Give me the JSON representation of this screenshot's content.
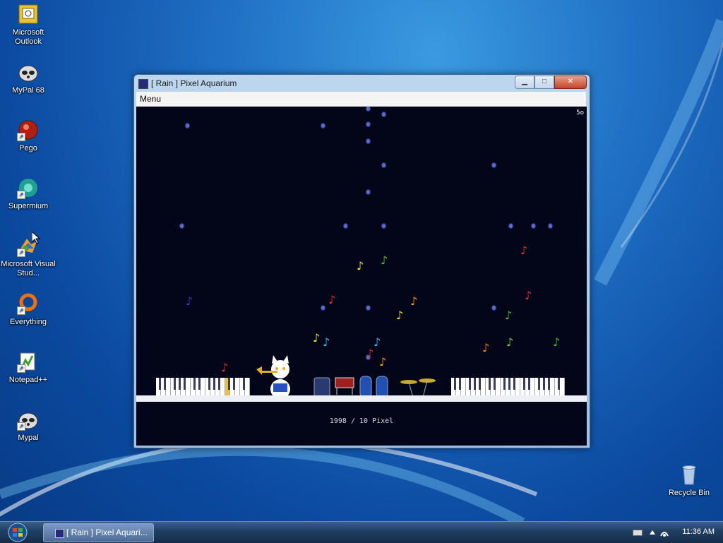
{
  "desktop": {
    "icons": [
      {
        "label": "Microsoft Outlook",
        "icon": "outlook-icon"
      },
      {
        "label": "MyPal 68",
        "icon": "raccoon-icon"
      },
      {
        "label": "Pego",
        "icon": "pego-icon"
      },
      {
        "label": "Supermium",
        "icon": "supermium-icon"
      },
      {
        "label": "Microsoft Visual Stud...",
        "icon": "visual-studio-icon"
      },
      {
        "label": "Everything",
        "icon": "everything-icon"
      },
      {
        "label": "Notepad++",
        "icon": "notepadpp-icon"
      },
      {
        "label": "Mypal",
        "icon": "raccoon-icon"
      },
      {
        "label": "Recycle Bin",
        "icon": "recycle-bin-icon"
      }
    ]
  },
  "window": {
    "title": "[ Rain ] Pixel Aquarium",
    "menu": "Menu",
    "fps": "5o",
    "credit": "1998 / 10  Pixel",
    "colors": {
      "background": "#030518",
      "rain": "#5a6ad8",
      "floor": "#eef0f5"
    }
  },
  "notes": [
    {
      "color": "#f0e040"
    },
    {
      "color": "#40c040"
    },
    {
      "color": "#e03030"
    },
    {
      "color": "#e03030"
    },
    {
      "color": "#3040d0"
    },
    {
      "color": "#e03030"
    },
    {
      "color": "#f0a020"
    },
    {
      "color": "#e0e040"
    },
    {
      "color": "#40c040"
    },
    {
      "color": "#40c040"
    },
    {
      "color": "#f0e040"
    },
    {
      "color": "#40c0e0"
    },
    {
      "color": "#40c0e0"
    },
    {
      "color": "#e03030"
    },
    {
      "color": "#f0a020"
    },
    {
      "color": "#f08020"
    },
    {
      "color": "#80d040"
    },
    {
      "color": "#e03030"
    }
  ],
  "taskbar": {
    "start": "Start",
    "task_label": "[ Rain ] Pixel Aquari...",
    "clock": "11:36 AM"
  }
}
